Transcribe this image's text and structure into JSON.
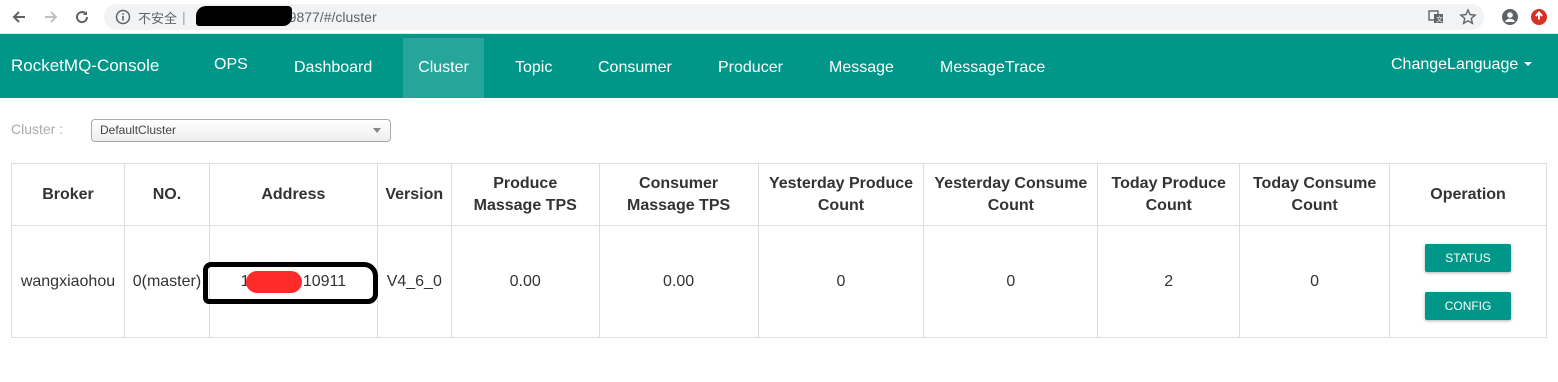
{
  "browser": {
    "insecure_label": "不安全",
    "separator": "|",
    "url_visible": "9877/#/cluster"
  },
  "navbar": {
    "brand": "RocketMQ-Console",
    "items": [
      {
        "label": "OPS"
      },
      {
        "label": "Dashboard"
      },
      {
        "label": "Cluster",
        "active": true
      },
      {
        "label": "Topic"
      },
      {
        "label": "Consumer"
      },
      {
        "label": "Producer"
      },
      {
        "label": "Message"
      },
      {
        "label": "MessageTrace"
      }
    ],
    "language": "ChangeLanguage"
  },
  "cluster": {
    "label": "Cluster :",
    "selected": "DefaultCluster"
  },
  "table": {
    "headers": [
      "Broker",
      "NO.",
      "Address",
      "Version",
      "Produce Massage TPS",
      "Consumer Massage TPS",
      "Yesterday Produce Count",
      "Yesterday Consume Count",
      "Today Produce Count",
      "Today Consume Count",
      "Operation"
    ],
    "rows": [
      {
        "broker": "wangxiaohou",
        "no": "0(master)",
        "address": "123.            .34:10911",
        "version": "V4_6_0",
        "produce_tps": "0.00",
        "consumer_tps": "0.00",
        "yesterday_produce": "0",
        "yesterday_consume": "0",
        "today_produce": "2",
        "today_consume": "0",
        "buttons": [
          "STATUS",
          "CONFIG"
        ]
      }
    ]
  },
  "colors": {
    "primary": "#009688",
    "active_tab": "#26a69a",
    "redaction_black": "#000000",
    "redaction_red": "#ff2a2a"
  }
}
